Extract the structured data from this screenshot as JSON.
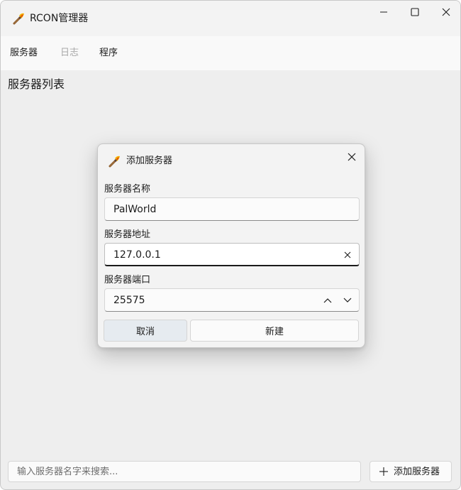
{
  "window": {
    "title": "RCON管理器",
    "app_icon": "torch-icon"
  },
  "menu": {
    "items": [
      {
        "label": "服务器",
        "enabled": true
      },
      {
        "label": "日志",
        "enabled": false
      },
      {
        "label": "程序",
        "enabled": true
      }
    ]
  },
  "main": {
    "section_title": "服务器列表"
  },
  "footer": {
    "search_placeholder": "输入服务器名字来搜索...",
    "add_button_label": "添加服务器"
  },
  "dialog": {
    "title": "添加服务器",
    "fields": {
      "name": {
        "label": "服务器名称",
        "value": "PalWorld"
      },
      "address": {
        "label": "服务器地址",
        "value": "127.0.0.1"
      },
      "port": {
        "label": "服务器端口",
        "value": "25575"
      }
    },
    "buttons": {
      "cancel": "取消",
      "create": "新建"
    }
  },
  "colors": {
    "window_bg": "#eeeeee",
    "menubar_bg": "#f9f9f9",
    "dialog_bg": "#f3f3f3",
    "disabled_text": "#a8a8a8",
    "cancel_button_bg": "#e6ebf0"
  }
}
